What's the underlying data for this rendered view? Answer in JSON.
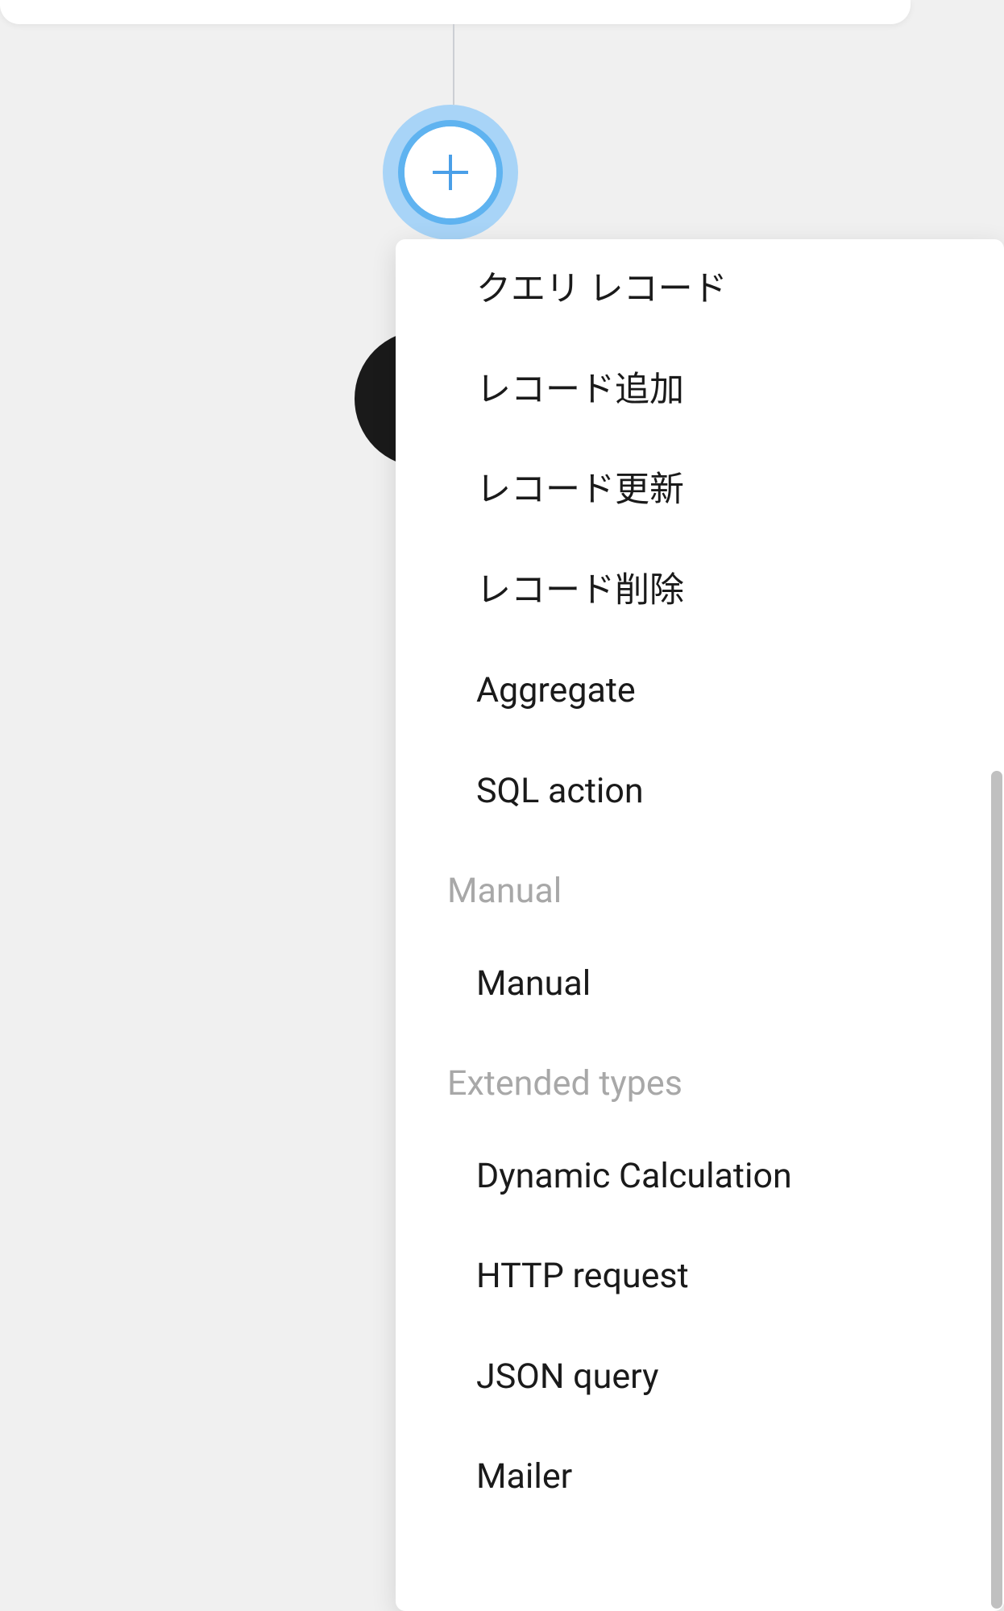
{
  "menu": {
    "items": [
      {
        "label": "クエリ レコード",
        "type": "item"
      },
      {
        "label": "レコード追加",
        "type": "item"
      },
      {
        "label": "レコード更新",
        "type": "item"
      },
      {
        "label": "レコード削除",
        "type": "item"
      },
      {
        "label": "Aggregate",
        "type": "item"
      },
      {
        "label": "SQL action",
        "type": "item"
      },
      {
        "label": "Manual",
        "type": "header"
      },
      {
        "label": "Manual",
        "type": "item"
      },
      {
        "label": "Extended types",
        "type": "header"
      },
      {
        "label": "Dynamic Calculation",
        "type": "item"
      },
      {
        "label": "HTTP request",
        "type": "item"
      },
      {
        "label": "JSON query",
        "type": "item"
      },
      {
        "label": "Mailer",
        "type": "item"
      }
    ]
  }
}
